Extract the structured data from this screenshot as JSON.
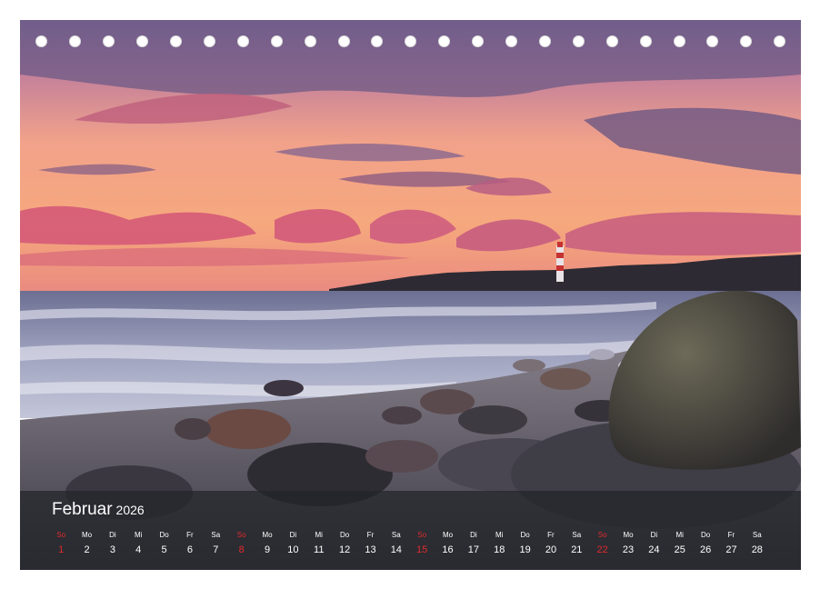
{
  "calendar": {
    "month": "Februar",
    "year": "2026",
    "days": [
      {
        "wd": "So",
        "day": "1",
        "sunday": true
      },
      {
        "wd": "Mo",
        "day": "2"
      },
      {
        "wd": "Di",
        "day": "3"
      },
      {
        "wd": "Mi",
        "day": "4"
      },
      {
        "wd": "Do",
        "day": "5"
      },
      {
        "wd": "Fr",
        "day": "6"
      },
      {
        "wd": "Sa",
        "day": "7"
      },
      {
        "wd": "So",
        "day": "8",
        "sunday": true
      },
      {
        "wd": "Mo",
        "day": "9"
      },
      {
        "wd": "Di",
        "day": "10"
      },
      {
        "wd": "Mi",
        "day": "11"
      },
      {
        "wd": "Do",
        "day": "12"
      },
      {
        "wd": "Fr",
        "day": "13"
      },
      {
        "wd": "Sa",
        "day": "14"
      },
      {
        "wd": "So",
        "day": "15",
        "sunday": true
      },
      {
        "wd": "Mo",
        "day": "16"
      },
      {
        "wd": "Di",
        "day": "17"
      },
      {
        "wd": "Mi",
        "day": "18"
      },
      {
        "wd": "Do",
        "day": "19"
      },
      {
        "wd": "Fr",
        "day": "20"
      },
      {
        "wd": "Sa",
        "day": "21"
      },
      {
        "wd": "So",
        "day": "22",
        "sunday": true
      },
      {
        "wd": "Mo",
        "day": "23"
      },
      {
        "wd": "Di",
        "day": "24"
      },
      {
        "wd": "Mi",
        "day": "25"
      },
      {
        "wd": "Do",
        "day": "26"
      },
      {
        "wd": "Fr",
        "day": "27"
      },
      {
        "wd": "Sa",
        "day": "28"
      }
    ]
  },
  "colors": {
    "sunday": "#e02b2b",
    "bar": "#22242a"
  }
}
